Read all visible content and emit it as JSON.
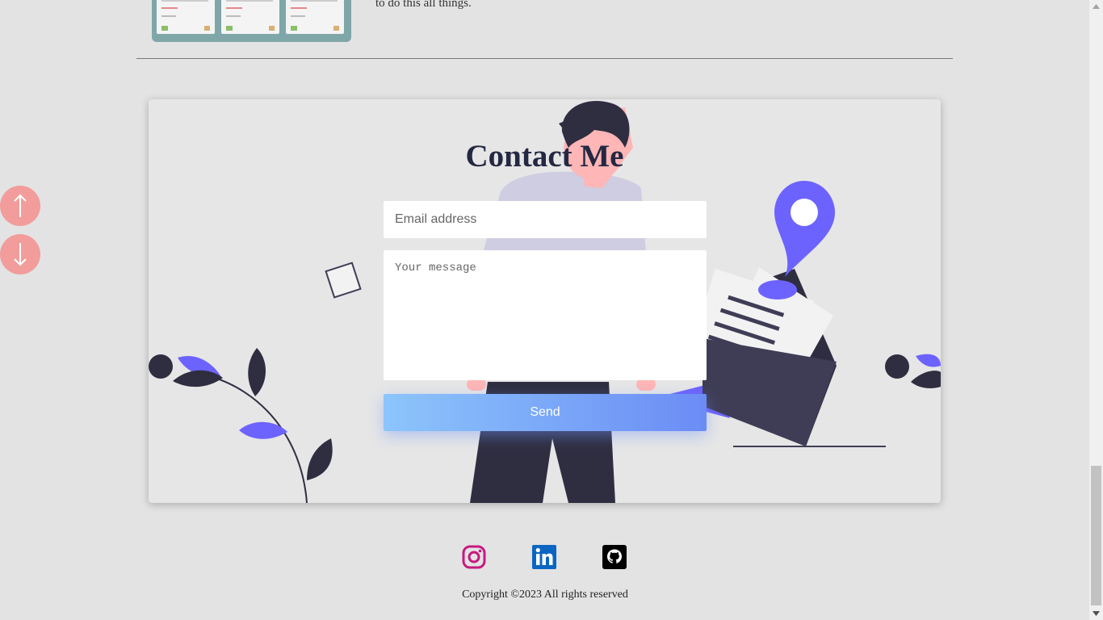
{
  "project": {
    "description_tail": "to do this all things."
  },
  "contact": {
    "title": "Contact Me",
    "email_placeholder": "Email address",
    "message_placeholder": "Your message",
    "send_label": "Send"
  },
  "scroll_buttons": {
    "up_icon": "arrow-up-icon",
    "down_icon": "arrow-down-icon",
    "color": "#f29c9c"
  },
  "socials": [
    {
      "name": "instagram",
      "icon": "instagram-icon",
      "color": "#c7197f"
    },
    {
      "name": "linkedin",
      "icon": "linkedin-icon",
      "color": "#0a66c2"
    },
    {
      "name": "github",
      "icon": "github-icon",
      "color": "#000000"
    }
  ],
  "footer": {
    "copyright": "Copyright ©2023 All rights reserved"
  },
  "colors": {
    "background": "#e3e3e3",
    "accent_purple": "#6c63ff",
    "dark_navy": "#2f2e41",
    "send_gradient_start": "#8cc5fb",
    "send_gradient_end": "#6b8cf5"
  }
}
